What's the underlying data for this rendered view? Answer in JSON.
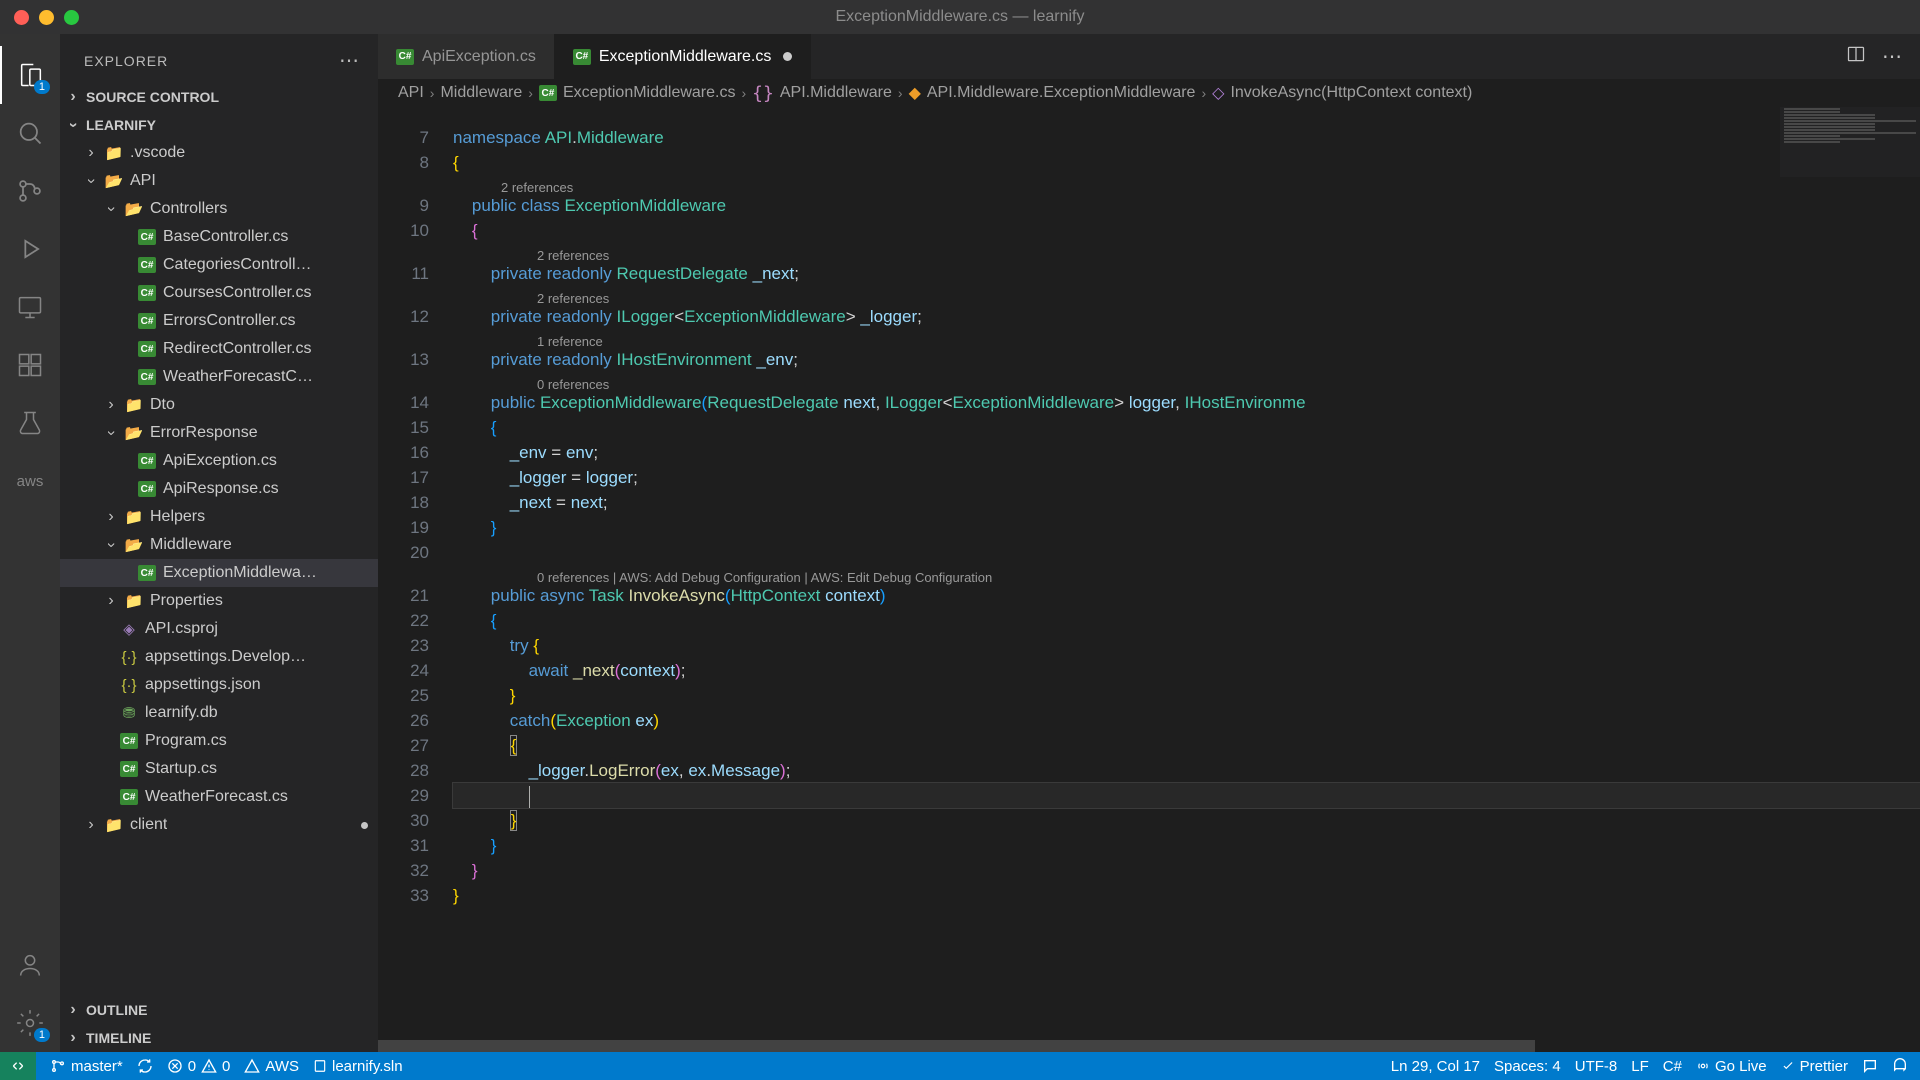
{
  "window_title": "ExceptionMiddleware.cs — learnify",
  "activity_bar": {
    "files_badge": "1",
    "aws_label": "aws",
    "settings_badge": "1"
  },
  "explorer": {
    "title": "EXPLORER",
    "source_control": "SOURCE CONTROL",
    "root": "LEARNIFY",
    "outline": "OUTLINE",
    "timeline": "TIMELINE",
    "vscode": ".vscode",
    "api": "API",
    "controllers": "Controllers",
    "base_ctrl": "BaseController.cs",
    "cat_ctrl": "CategoriesControll…",
    "courses_ctrl": "CoursesController.cs",
    "errors_ctrl": "ErrorsController.cs",
    "redirect_ctrl": "RedirectController.cs",
    "weather_ctrl": "WeatherForecastC…",
    "dto": "Dto",
    "error_response": "ErrorResponse",
    "api_exception": "ApiException.cs",
    "api_response": "ApiResponse.cs",
    "helpers": "Helpers",
    "middleware": "Middleware",
    "exception_mw": "ExceptionMiddlewa…",
    "properties": "Properties",
    "api_csproj": "API.csproj",
    "appsettings_dev": "appsettings.Develop…",
    "appsettings": "appsettings.json",
    "learnify_db": "learnify.db",
    "program": "Program.cs",
    "startup": "Startup.cs",
    "weather_forecast": "WeatherForecast.cs",
    "client": "client"
  },
  "tabs": {
    "tab1": "ApiException.cs",
    "tab2": "ExceptionMiddleware.cs"
  },
  "breadcrumbs": {
    "p1": "API",
    "p2": "Middleware",
    "p3": "ExceptionMiddleware.cs",
    "p4": "API.Middleware",
    "p5": "API.Middleware.ExceptionMiddleware",
    "p6": "InvokeAsync(HttpContext context)"
  },
  "codelens": {
    "l1": "2 references",
    "l2": "2 references",
    "l3": "2 references",
    "l4": "1 reference",
    "l5": "0 references",
    "l6": "0 references | AWS: Add Debug Configuration | AWS: Edit Debug Configuration"
  },
  "line_numbers": [
    "7",
    "8",
    "",
    "9",
    "10",
    "",
    "11",
    "",
    "12",
    "",
    "13",
    "",
    "14",
    "15",
    "16",
    "17",
    "18",
    "19",
    "20",
    "",
    "21",
    "22",
    "23",
    "24",
    "25",
    "26",
    "27",
    "28",
    "29",
    "30",
    "31",
    "32",
    "33"
  ],
  "status": {
    "branch": "master*",
    "errors": "0",
    "warnings": "0",
    "aws": "AWS",
    "sln": "learnify.sln",
    "pos": "Ln 29, Col 17",
    "spaces": "Spaces: 4",
    "encoding": "UTF-8",
    "eol": "LF",
    "lang": "C#",
    "golive": "Go Live",
    "prettier": "Prettier"
  }
}
